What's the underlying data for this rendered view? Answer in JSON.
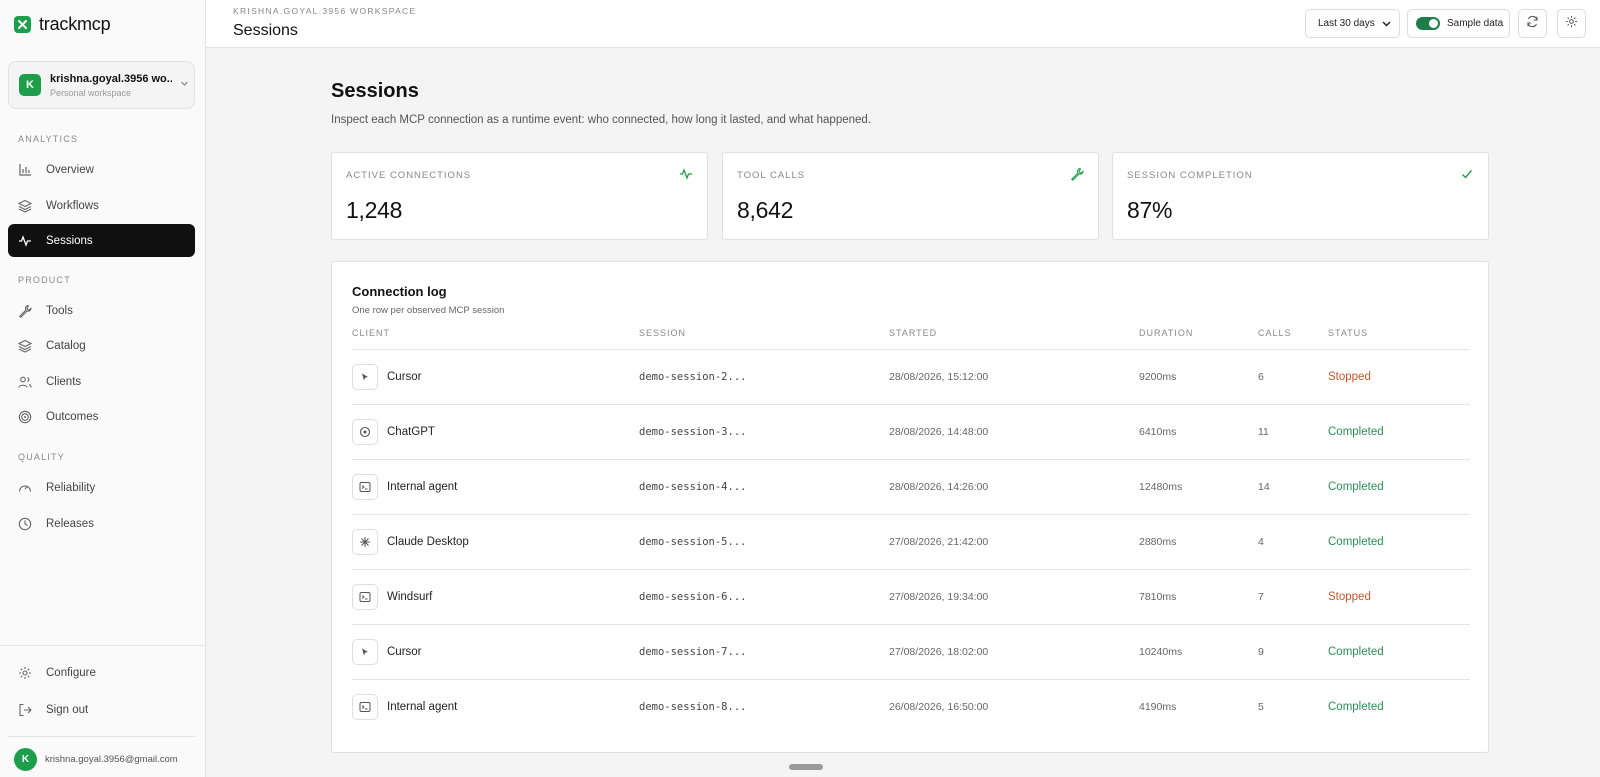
{
  "brand": {
    "name": "trackmcp"
  },
  "workspace": {
    "initial": "K",
    "name": "krishna.goyal.3956 wo...",
    "subtitle": "Personal workspace"
  },
  "sidebar": {
    "sections": [
      {
        "label": "ANALYTICS",
        "items": [
          {
            "label": "Overview",
            "icon": "bar-chart-icon"
          },
          {
            "label": "Workflows",
            "icon": "layers-icon"
          },
          {
            "label": "Sessions",
            "icon": "activity-icon",
            "active": true
          }
        ]
      },
      {
        "label": "PRODUCT",
        "items": [
          {
            "label": "Tools",
            "icon": "wrench-icon"
          },
          {
            "label": "Catalog",
            "icon": "layers-icon"
          },
          {
            "label": "Clients",
            "icon": "users-icon"
          },
          {
            "label": "Outcomes",
            "icon": "target-icon"
          }
        ]
      },
      {
        "label": "QUALITY",
        "items": [
          {
            "label": "Reliability",
            "icon": "gauge-icon"
          },
          {
            "label": "Releases",
            "icon": "clock-icon"
          }
        ]
      }
    ],
    "footer": [
      {
        "label": "Configure",
        "icon": "gear-icon"
      },
      {
        "label": "Sign out",
        "icon": "logout-icon"
      }
    ],
    "user": {
      "initial": "K",
      "email": "krishna.goyal.3956@gmail.com"
    }
  },
  "topbar": {
    "workspace_label": "KRISHNA.GOYAL.3956 WORKSPACE",
    "title": "Sessions",
    "range": "Last 30 days",
    "sample_label": "Sample data",
    "sample_on": true
  },
  "page": {
    "heading": "Sessions",
    "subtitle": "Inspect each MCP connection as a runtime event: who connected, how long it lasted, and what happened."
  },
  "stats": [
    {
      "label": "ACTIVE CONNECTIONS",
      "value": "1,248",
      "icon": "activity-icon"
    },
    {
      "label": "TOOL CALLS",
      "value": "8,642",
      "icon": "wrench-icon"
    },
    {
      "label": "SESSION COMPLETION",
      "value": "87%",
      "icon": "check-icon"
    }
  ],
  "log": {
    "title": "Connection log",
    "subtitle": "One row per observed MCP session",
    "columns": [
      "CLIENT",
      "SESSION",
      "STARTED",
      "DURATION",
      "CALLS",
      "STATUS"
    ],
    "rows": [
      {
        "client": "Cursor",
        "icon": "cursor-icon",
        "session": "demo-session-2...",
        "started": "28/08/2026, 15:12:00",
        "duration": "9200ms",
        "calls": "6",
        "status": "Stopped"
      },
      {
        "client": "ChatGPT",
        "icon": "chatgpt-icon",
        "session": "demo-session-3...",
        "started": "28/08/2026, 14:48:00",
        "duration": "6410ms",
        "calls": "11",
        "status": "Completed"
      },
      {
        "client": "Internal agent",
        "icon": "terminal-icon",
        "session": "demo-session-4...",
        "started": "28/08/2026, 14:26:00",
        "duration": "12480ms",
        "calls": "14",
        "status": "Completed"
      },
      {
        "client": "Claude Desktop",
        "icon": "sparkle-icon",
        "session": "demo-session-5...",
        "started": "27/08/2026, 21:42:00",
        "duration": "2880ms",
        "calls": "4",
        "status": "Completed"
      },
      {
        "client": "Windsurf",
        "icon": "terminal-icon",
        "session": "demo-session-6...",
        "started": "27/08/2026, 19:34:00",
        "duration": "7810ms",
        "calls": "7",
        "status": "Stopped"
      },
      {
        "client": "Cursor",
        "icon": "cursor-icon",
        "session": "demo-session-7...",
        "started": "27/08/2026, 18:02:00",
        "duration": "10240ms",
        "calls": "9",
        "status": "Completed"
      },
      {
        "client": "Internal agent",
        "icon": "terminal-icon",
        "session": "demo-session-8...",
        "started": "26/08/2026, 16:50:00",
        "duration": "4190ms",
        "calls": "5",
        "status": "Completed"
      }
    ]
  },
  "colors": {
    "brand": "#1e9e4a",
    "stopped": "#c2572b",
    "completed": "#2e8b57",
    "active_nav": "#101010"
  }
}
